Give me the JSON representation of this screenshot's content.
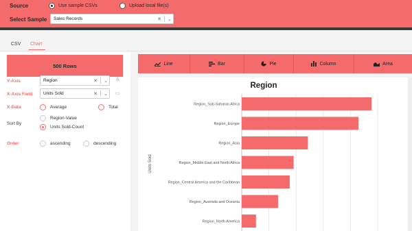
{
  "header": {
    "source_label": "Source",
    "source_options": [
      {
        "label": "Use sample CSVs",
        "selected": true
      },
      {
        "label": "Upload local file(s)",
        "selected": false
      }
    ],
    "select_sample_label": "Select Sample",
    "select_sample_value": "Sales Records"
  },
  "tabs": [
    {
      "label": "CSV",
      "active": false
    },
    {
      "label": "Chart",
      "active": true
    }
  ],
  "panel": {
    "rows_label": "500 Rows",
    "y_axis_label": "Y-Axis",
    "y_axis_value": "Region",
    "x_axis_field_label": "X-Axis Field",
    "x_axis_field_value": "Units Sold",
    "x_data_label": "X-Data",
    "x_data_options": [
      {
        "label": "Average",
        "selected": false
      },
      {
        "label": "Total",
        "selected": false
      }
    ],
    "sort_by_label": "Sort By",
    "sort_by_options": [
      {
        "label": "Region-Value",
        "selected": false
      },
      {
        "label": "Units Sold-Count",
        "selected": true
      }
    ],
    "order_label": "Order",
    "order_options": [
      {
        "label": "ascending",
        "selected": false
      },
      {
        "label": "descending",
        "selected": false
      }
    ]
  },
  "chart_types": [
    {
      "label": "Line",
      "icon": "line-chart-icon"
    },
    {
      "label": "Bar",
      "icon": "bar-chart-icon"
    },
    {
      "label": "Pie",
      "icon": "pie-chart-icon"
    },
    {
      "label": "Column",
      "icon": "column-chart-icon"
    },
    {
      "label": "Area",
      "icon": "area-chart-icon"
    }
  ],
  "colors": {
    "accent": "#f56b6b",
    "dark": "#3a3a3a"
  },
  "chart_data": {
    "type": "bar",
    "orientation": "horizontal",
    "title": "Region",
    "ylabel": "Units Sold",
    "categories": [
      "Region_Sub-Saharan Africa",
      "Region_Europe",
      "Region_Asia",
      "Region_Middle East and North Africa",
      "Region_Central America and the Caribbean",
      "Region_Australia and Oceania",
      "Region_North America"
    ],
    "values": [
      100,
      90,
      51,
      40,
      37,
      28,
      11
    ],
    "grid": true
  }
}
